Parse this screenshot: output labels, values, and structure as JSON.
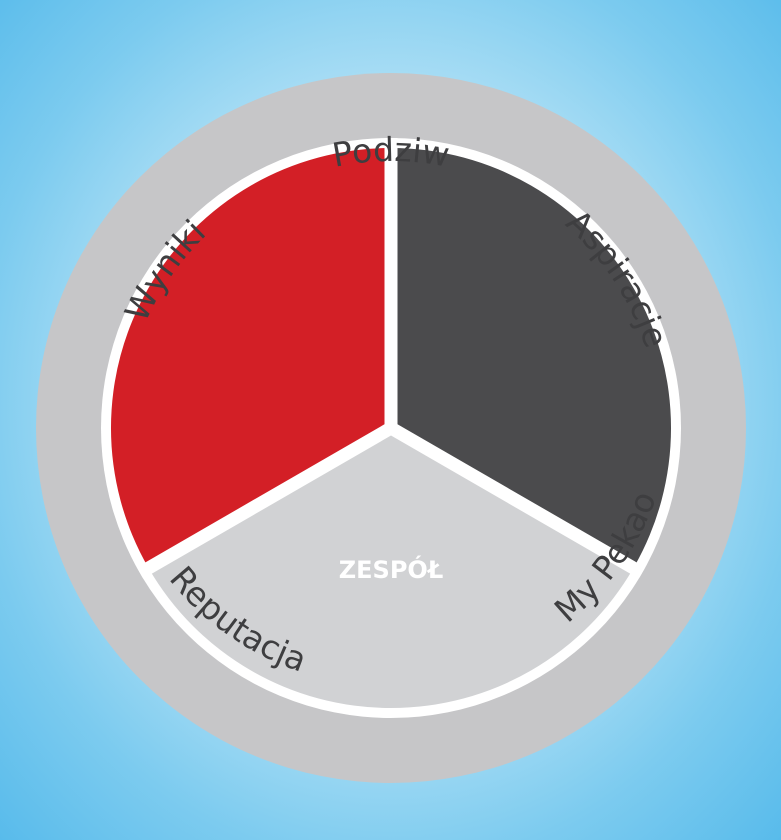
{
  "diagram": {
    "center_label": "ZESPÓŁ",
    "ring_labels": {
      "top": "Podziw",
      "upper_right": "Aspiracje",
      "lower_right": "My Pekao",
      "lower_left": "Reputacja",
      "upper_left": "Wyniki"
    },
    "colors": {
      "outer_ring": "#c6c6c8",
      "separator": "#ffffff",
      "segment_red": "#d31f26",
      "segment_dark": "#4b4b4d",
      "segment_light": "#d1d2d4",
      "label_text": "#3e3e40",
      "center_text": "#ffffff"
    }
  }
}
